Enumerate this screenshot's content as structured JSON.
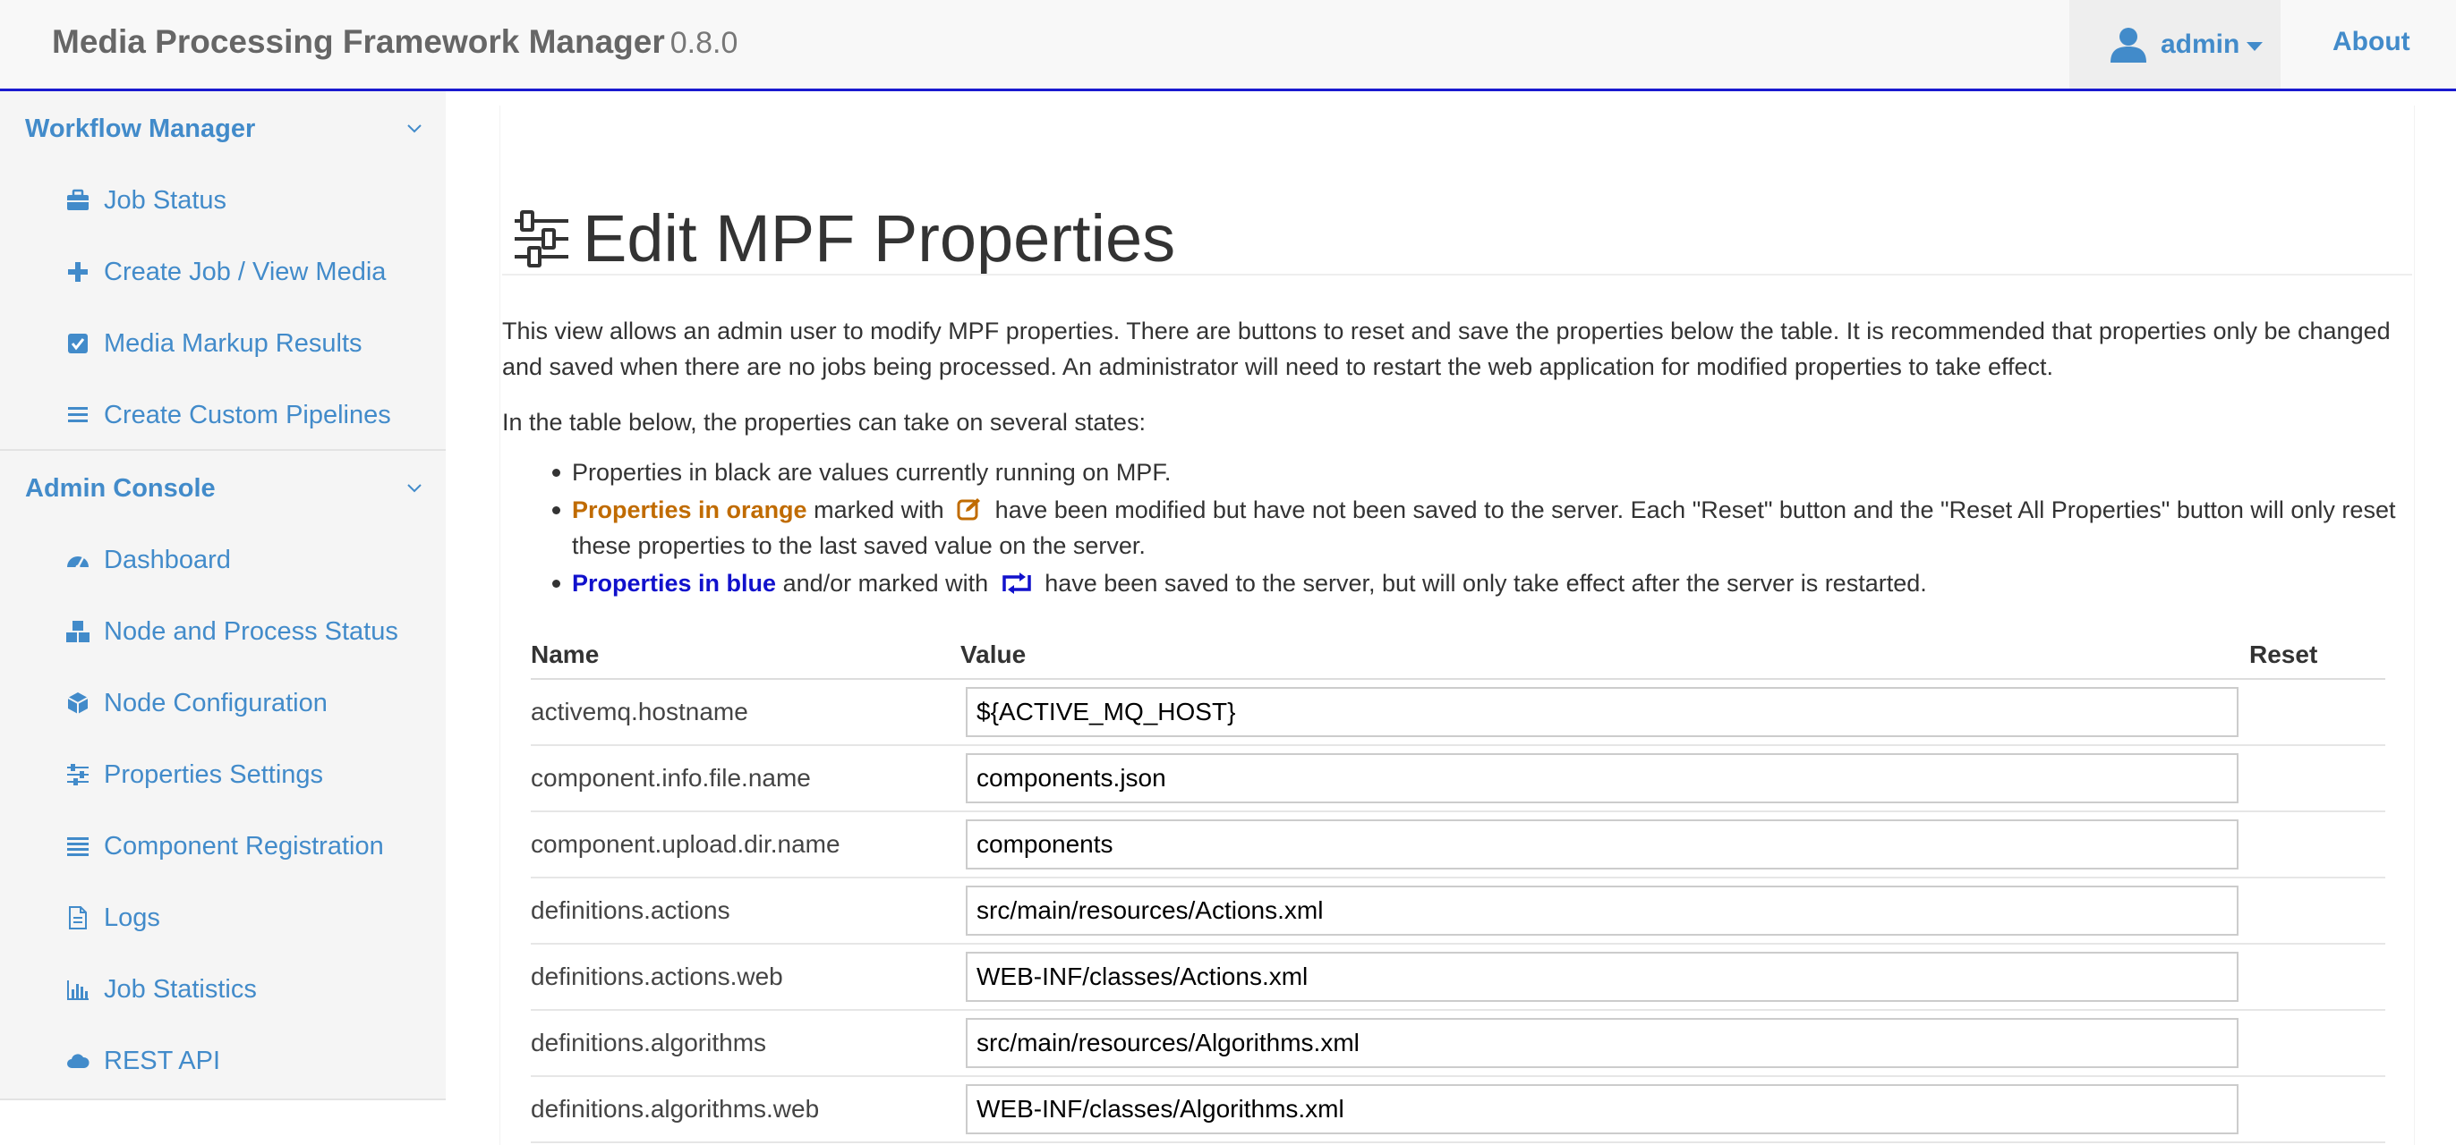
{
  "header": {
    "brand": "Media Processing Framework Manager",
    "version": "0.8.0",
    "user_label": "admin",
    "about_label": "About"
  },
  "sidebar": {
    "sections": [
      {
        "title": "Workflow Manager",
        "items": [
          {
            "label": "Job Status",
            "icon": "briefcase-icon"
          },
          {
            "label": "Create Job / View Media",
            "icon": "plus-icon"
          },
          {
            "label": "Media Markup Results",
            "icon": "checkbox-icon"
          },
          {
            "label": "Create Custom Pipelines",
            "icon": "list-icon"
          }
        ]
      },
      {
        "title": "Admin Console",
        "items": [
          {
            "label": "Dashboard",
            "icon": "dashboard-icon"
          },
          {
            "label": "Node and Process Status",
            "icon": "cubes-icon"
          },
          {
            "label": "Node Configuration",
            "icon": "cube-icon"
          },
          {
            "label": "Properties Settings",
            "icon": "sliders-icon"
          },
          {
            "label": "Component Registration",
            "icon": "align-justify-icon"
          },
          {
            "label": "Logs",
            "icon": "file-icon"
          },
          {
            "label": "Job Statistics",
            "icon": "bar-chart-icon"
          },
          {
            "label": "REST API",
            "icon": "cloud-icon"
          }
        ]
      }
    ]
  },
  "main": {
    "title": "Edit MPF Properties",
    "intro": "This view allows an admin user to modify MPF properties. There are buttons to reset and save the properties below the table. It is recommended that properties only be changed and saved when there are no jobs being processed. An administrator will need to restart the web application for modified properties to take effect.",
    "states_lead": "In the table below, the properties can take on several states:",
    "states": {
      "black": "Properties in black are values currently running on MPF.",
      "orange_label": "Properties in orange",
      "orange_mid": "marked with",
      "orange_rest": "have been modified but have not been saved to the server. Each \"Reset\" button and the \"Reset All Properties\" button will only reset these properties to the last saved value on the server.",
      "blue_label": "Properties in blue",
      "blue_mid": "and/or marked with",
      "blue_rest": "have been saved to the server, but will only take effect after the server is restarted."
    },
    "colors": {
      "orange": "#c06b00",
      "blue": "#1111cc",
      "link": "#428bca"
    }
  },
  "table": {
    "headers": {
      "name": "Name",
      "value": "Value",
      "reset": "Reset"
    },
    "rows": [
      {
        "name": "activemq.hostname",
        "value": "${ACTIVE_MQ_HOST}"
      },
      {
        "name": "component.info.file.name",
        "value": "components.json"
      },
      {
        "name": "component.upload.dir.name",
        "value": "components"
      },
      {
        "name": "definitions.actions",
        "value": "src/main/resources/Actions.xml"
      },
      {
        "name": "definitions.actions.web",
        "value": "WEB-INF/classes/Actions.xml"
      },
      {
        "name": "definitions.algorithms",
        "value": "src/main/resources/Algorithms.xml"
      },
      {
        "name": "definitions.algorithms.web",
        "value": "WEB-INF/classes/Algorithms.xml"
      }
    ]
  }
}
